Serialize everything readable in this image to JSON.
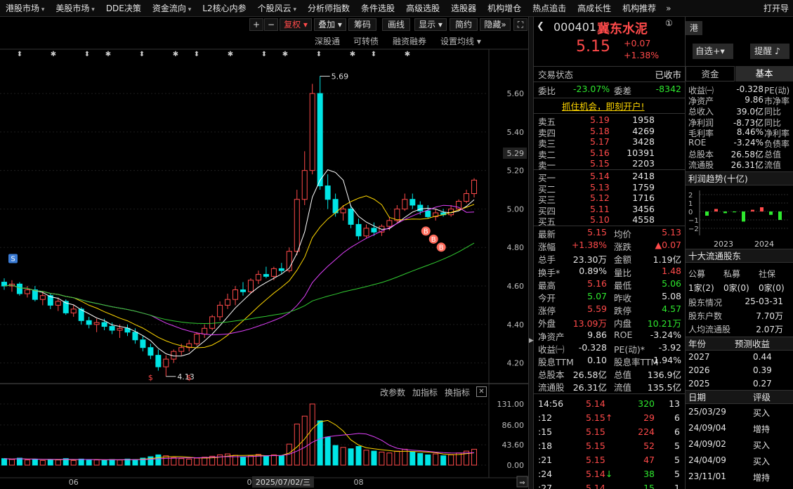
{
  "topnav": {
    "items": [
      "港股市场",
      "美股市场",
      "DDE决策",
      "资金流向",
      "L2核心内参",
      "个股风云",
      "分析师指数",
      "条件选股",
      "高级选股",
      "选股器",
      "机构增仓",
      "热点追击",
      "高成长性",
      "机构推荐"
    ],
    "dropdown": [
      true,
      true,
      false,
      true,
      false,
      true,
      false,
      false,
      false,
      false,
      false,
      false,
      false,
      false
    ],
    "more": "»",
    "right": "打开导"
  },
  "toolbar": {
    "plus": "+",
    "minus": "−",
    "fuquan": "复权",
    "overlay": "叠加",
    "chips": "筹码",
    "draw": "画线",
    "display": "显示",
    "simple": "简约",
    "hide": "隐藏",
    "more": "»",
    "fullscreen": "⛶"
  },
  "subtoolbar": {
    "shen": "深股通",
    "convert": "可转债",
    "margin": "融资融券",
    "ma_settings": "设置均线"
  },
  "indicator_toolbar": {
    "params": "改参数",
    "add": "加指标",
    "switch": "换指标",
    "close": "✕"
  },
  "price_axis": [
    "5.60",
    "5.40",
    "5.29",
    "5.20",
    "5.00",
    "4.80",
    "4.60",
    "4.40",
    "4.20"
  ],
  "vol_axis": [
    "131.00",
    "86.00",
    "43.60",
    "0.00"
  ],
  "date_axis": {
    "m1": "06",
    "m2": "0",
    "cursor": "2025/07/02/三",
    "m3": "08",
    "scroll": "⇒"
  },
  "annotations": {
    "high": "5.69",
    "low": "4.13",
    "s_label": "S",
    "b_label": "B",
    "s_marker": "$"
  },
  "colors": {
    "up": "#ff4a4a",
    "down": "#00e5e5",
    "ma5": "#ffffff",
    "ma10": "#ffd700",
    "ma20": "#e040fb",
    "ma60": "#32cd32"
  },
  "chart_data": {
    "type": "candlestick",
    "series": [
      {
        "name": "price",
        "values": [
          [
            4.62,
            4.64,
            4.58,
            4.6
          ],
          [
            4.6,
            4.63,
            4.57,
            4.61
          ],
          [
            4.61,
            4.62,
            4.55,
            4.56
          ],
          [
            4.56,
            4.6,
            4.54,
            4.58
          ],
          [
            4.58,
            4.6,
            4.52,
            4.53
          ],
          [
            4.53,
            4.57,
            4.5,
            4.55
          ],
          [
            4.55,
            4.56,
            4.48,
            4.5
          ],
          [
            4.5,
            4.54,
            4.47,
            4.52
          ],
          [
            4.52,
            4.53,
            4.45,
            4.46
          ],
          [
            4.46,
            4.5,
            4.44,
            4.48
          ],
          [
            4.48,
            4.49,
            4.4,
            4.42
          ],
          [
            4.42,
            4.44,
            4.38,
            4.4
          ],
          [
            4.4,
            4.43,
            4.36,
            4.41
          ],
          [
            4.41,
            4.43,
            4.37,
            4.39
          ],
          [
            4.39,
            4.41,
            4.35,
            4.37
          ],
          [
            4.37,
            4.4,
            4.33,
            4.38
          ],
          [
            4.38,
            4.4,
            4.34,
            4.36
          ],
          [
            4.36,
            4.38,
            4.3,
            4.32
          ],
          [
            4.32,
            4.34,
            4.26,
            4.28
          ],
          [
            4.28,
            4.3,
            4.22,
            4.24
          ],
          [
            4.24,
            4.27,
            4.16,
            4.18
          ],
          [
            4.18,
            4.24,
            4.13,
            4.22
          ],
          [
            4.22,
            4.27,
            4.2,
            4.26
          ],
          [
            4.26,
            4.3,
            4.24,
            4.28
          ],
          [
            4.28,
            4.32,
            4.26,
            4.3
          ],
          [
            4.3,
            4.36,
            4.29,
            4.35
          ],
          [
            4.35,
            4.4,
            4.33,
            4.38
          ],
          [
            4.38,
            4.45,
            4.37,
            4.44
          ],
          [
            4.44,
            4.52,
            4.42,
            4.5
          ],
          [
            4.5,
            4.56,
            4.48,
            4.53
          ],
          [
            4.53,
            4.6,
            4.5,
            4.58
          ],
          [
            4.58,
            4.62,
            4.55,
            4.57
          ],
          [
            4.57,
            4.64,
            4.56,
            4.63
          ],
          [
            4.63,
            4.68,
            4.61,
            4.66
          ],
          [
            4.66,
            4.7,
            4.64,
            4.65
          ],
          [
            4.65,
            4.7,
            4.63,
            4.69
          ],
          [
            4.69,
            4.72,
            4.66,
            4.68
          ],
          [
            4.68,
            4.8,
            4.67,
            4.78
          ],
          [
            4.78,
            5.1,
            4.76,
            5.05
          ],
          [
            5.05,
            5.3,
            5.02,
            5.2
          ],
          [
            5.2,
            5.65,
            5.18,
            5.6
          ],
          [
            5.6,
            5.69,
            5.1,
            5.12
          ],
          [
            5.12,
            5.18,
            5.0,
            5.05
          ],
          [
            5.05,
            5.08,
            4.96,
            4.98
          ],
          [
            4.98,
            5.02,
            4.94,
            5.0
          ],
          [
            5.0,
            5.02,
            4.9,
            4.92
          ],
          [
            4.92,
            4.95,
            4.84,
            4.86
          ],
          [
            4.86,
            4.92,
            4.85,
            4.9
          ],
          [
            4.9,
            4.93,
            4.86,
            4.88
          ],
          [
            4.88,
            4.92,
            4.86,
            4.91
          ],
          [
            4.91,
            4.96,
            4.89,
            4.94
          ],
          [
            4.94,
            5.02,
            4.93,
            5.0
          ],
          [
            5.0,
            5.08,
            4.99,
            5.05
          ],
          [
            5.05,
            5.08,
            5.0,
            5.02
          ],
          [
            5.02,
            5.04,
            4.97,
            4.99
          ],
          [
            4.99,
            5.02,
            4.95,
            4.96
          ],
          [
            4.96,
            5.0,
            4.94,
            4.98
          ],
          [
            4.98,
            5.0,
            4.96,
            4.97
          ],
          [
            4.97,
            5.02,
            4.96,
            5.0
          ],
          [
            5.0,
            5.05,
            4.99,
            5.04
          ],
          [
            5.04,
            5.1,
            5.03,
            5.08
          ],
          [
            5.08,
            5.16,
            5.06,
            5.15
          ]
        ]
      },
      {
        "name": "volume",
        "values": [
          14,
          12,
          15,
          11,
          13,
          10,
          12,
          11,
          14,
          10,
          13,
          12,
          11,
          10,
          12,
          11,
          13,
          12,
          15,
          18,
          22,
          20,
          16,
          14,
          13,
          15,
          17,
          19,
          22,
          24,
          21,
          18,
          20,
          23,
          19,
          22,
          20,
          45,
          88,
          105,
          131,
          95,
          60,
          42,
          38,
          35,
          40,
          32,
          30,
          28,
          26,
          30,
          34,
          28,
          25,
          22,
          24,
          20,
          22,
          26,
          30,
          34
        ]
      }
    ],
    "price_range": [
      4.1,
      5.75
    ],
    "volume_range": [
      0,
      140
    ],
    "grid": true
  },
  "quote": {
    "code": "000401",
    "name": "冀东水泥",
    "badge": "①",
    "price": "5.15",
    "change": "+0.07",
    "change_pct": "+1.38%",
    "rong": "融",
    "gang": "港",
    "zixuan": "自选",
    "zixuan_plus": "+",
    "alert": "提醒",
    "state_label": "交易状态",
    "state": "已收市",
    "weibi_label": "委比",
    "weibi": "-23.07%",
    "weicha_label": "委差",
    "weicha": "-8342",
    "ad": "抓住机会，即刻开户!",
    "asks": [
      {
        "label": "卖五",
        "price": "5.19",
        "vol": "1958"
      },
      {
        "label": "卖四",
        "price": "5.18",
        "vol": "4269"
      },
      {
        "label": "卖三",
        "price": "5.17",
        "vol": "3428"
      },
      {
        "label": "卖二",
        "price": "5.16",
        "vol": "10391"
      },
      {
        "label": "卖一",
        "price": "5.15",
        "vol": "2203"
      }
    ],
    "bids": [
      {
        "label": "买一",
        "price": "5.14",
        "vol": "2418"
      },
      {
        "label": "买二",
        "price": "5.13",
        "vol": "1759"
      },
      {
        "label": "买三",
        "price": "5.12",
        "vol": "1716"
      },
      {
        "label": "买四",
        "price": "5.11",
        "vol": "3456"
      },
      {
        "label": "买五",
        "price": "5.10",
        "vol": "4558"
      }
    ],
    "stats": [
      {
        "l1": "最新",
        "v1": "5.15",
        "c1": "red",
        "l2": "均价",
        "v2": "5.13",
        "c2": "red"
      },
      {
        "l1": "涨幅",
        "v1": "+1.38%",
        "c1": "red",
        "l2": "涨跌",
        "v2": "▲0.07",
        "c2": "red"
      },
      {
        "l1": "总手",
        "v1": "23.30万",
        "c1": "white",
        "l2": "金额",
        "v2": "1.19亿",
        "c2": "white"
      },
      {
        "l1": "换手*",
        "v1": "0.89%",
        "c1": "white",
        "l2": "量比",
        "v2": "1.48",
        "c2": "red"
      },
      {
        "l1": "最高",
        "v1": "5.16",
        "c1": "red",
        "l2": "最低",
        "v2": "5.06",
        "c2": "green"
      },
      {
        "l1": "今开",
        "v1": "5.07",
        "c1": "green",
        "l2": "昨收",
        "v2": "5.08",
        "c2": "white"
      },
      {
        "l1": "涨停",
        "v1": "5.59",
        "c1": "red",
        "l2": "跌停",
        "v2": "4.57",
        "c2": "green"
      },
      {
        "l1": "外盘",
        "v1": "13.09万",
        "c1": "red",
        "l2": "内盘",
        "v2": "10.21万",
        "c2": "green"
      },
      {
        "l1": "净资产",
        "v1": "9.86",
        "c1": "white",
        "l2": "ROE",
        "v2": "-3.24%",
        "c2": "white"
      },
      {
        "l1": "收益㈠",
        "v1": "-0.328",
        "c1": "white",
        "l2": "PE(动)*",
        "v2": "-3.92",
        "c2": "white"
      },
      {
        "l1": "股息TTM",
        "v1": "0.10",
        "c1": "white",
        "l2": "股息率TTM",
        "v2": "1.94%",
        "c2": "white"
      },
      {
        "l1": "总股本",
        "v1": "26.58亿",
        "c1": "white",
        "l2": "总值",
        "v2": "136.9亿",
        "c2": "white"
      },
      {
        "l1": "流通股",
        "v1": "26.31亿",
        "c1": "white",
        "l2": "流值",
        "v2": "135.5亿",
        "c2": "white"
      }
    ],
    "ticks": [
      {
        "time": "14:56",
        "price": "5.14",
        "arrow": "",
        "vol": "320",
        "vc": "green",
        "n": "13"
      },
      {
        "time": ":12",
        "price": "5.15",
        "arrow": "↑",
        "vol": "29",
        "vc": "red",
        "n": "6"
      },
      {
        "time": ":15",
        "price": "5.15",
        "arrow": "",
        "vol": "224",
        "vc": "red",
        "n": "6"
      },
      {
        "time": ":18",
        "price": "5.15",
        "arrow": "",
        "vol": "52",
        "vc": "red",
        "n": "5"
      },
      {
        "time": ":21",
        "price": "5.15",
        "arrow": "",
        "vol": "47",
        "vc": "red",
        "n": "5"
      },
      {
        "time": ":24",
        "price": "5.14",
        "arrow": "↓",
        "vol": "38",
        "vc": "green",
        "n": "5"
      },
      {
        "time": ":27",
        "price": "5.14",
        "arrow": "",
        "vol": "15",
        "vc": "green",
        "n": "1"
      }
    ]
  },
  "fund": {
    "tab_funds": "资金",
    "tab_basic": "基本",
    "rows": [
      {
        "l": "收益㈠",
        "v": "-0.328",
        "r": "PE(动)"
      },
      {
        "l": "净资产",
        "v": "9.86",
        "r": "市净率"
      },
      {
        "l": "总收入",
        "v": "39.0亿",
        "r": "同比"
      },
      {
        "l": "净利润",
        "v": "-8.73亿",
        "r": "同比"
      },
      {
        "l": "毛利率",
        "v": "8.46%",
        "r": "净利率"
      },
      {
        "l": "ROE",
        "v": "-3.24%",
        "r": "负债率"
      },
      {
        "l": "总股本",
        "v": "26.58亿",
        "r": "总值"
      },
      {
        "l": "流通股",
        "v": "26.31亿",
        "r": "流值"
      }
    ],
    "profit_title": "利润趋势(十亿)",
    "profit_axis": [
      "2",
      "1",
      "0",
      "−1",
      "−2"
    ],
    "profit_years": [
      "2023",
      "2024"
    ],
    "profit_data": [
      -0.5,
      0.3,
      -0.2,
      -0.1,
      -1.2,
      0.2,
      0.5,
      -0.4,
      -1.0
    ],
    "holders_title": "十大流通股东",
    "holder_types": [
      "公募",
      "私募",
      "社保"
    ],
    "holder_counts": [
      "1家(2)",
      "0家(0)",
      "0家(0)"
    ],
    "holder_info": [
      {
        "l": "股东情况",
        "v": "25-03-31"
      },
      {
        "l": "股东户数",
        "v": "7.70万"
      },
      {
        "l": "人均流通股",
        "v": "2.07万"
      }
    ],
    "forecast_head": [
      "年份",
      "预测收益"
    ],
    "forecast": [
      {
        "y": "2027",
        "v": "0.44"
      },
      {
        "y": "2026",
        "v": "0.39"
      },
      {
        "y": "2025",
        "v": "0.27"
      }
    ],
    "rating_head": [
      "日期",
      "评级"
    ],
    "ratings": [
      {
        "d": "25/03/29",
        "r": "买入"
      },
      {
        "d": "24/09/04",
        "r": "增持"
      },
      {
        "d": "24/09/02",
        "r": "买入"
      },
      {
        "d": "24/04/09",
        "r": "买入"
      },
      {
        "d": "23/11/01",
        "r": "增持"
      }
    ]
  }
}
